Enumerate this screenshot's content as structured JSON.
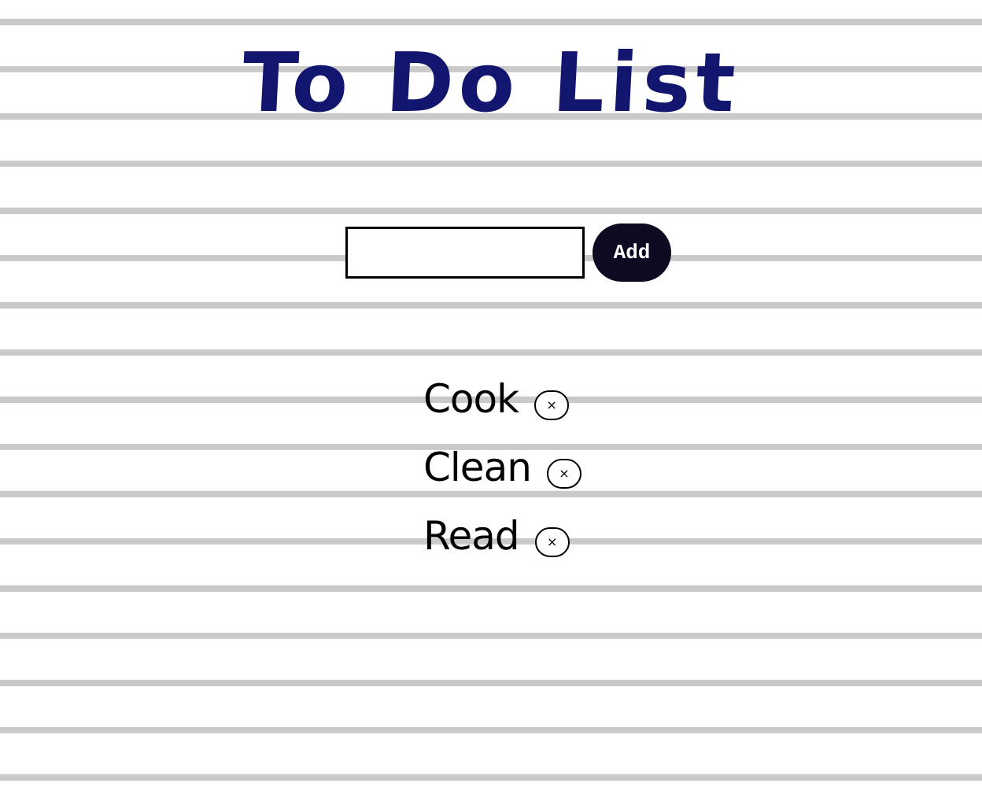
{
  "title": "To Do List",
  "form": {
    "input_value": "",
    "add_label": "Add"
  },
  "todos": [
    {
      "text": "Cook",
      "delete_glyph": "×"
    },
    {
      "text": "Clean",
      "delete_glyph": "×"
    },
    {
      "text": "Read",
      "delete_glyph": "×"
    }
  ],
  "colors": {
    "title": "#13166e",
    "button_bg": "#0c0b22",
    "ruled_line": "#c9c9c9",
    "background": "#ffffff"
  },
  "icons": {
    "delete": "close-icon"
  }
}
